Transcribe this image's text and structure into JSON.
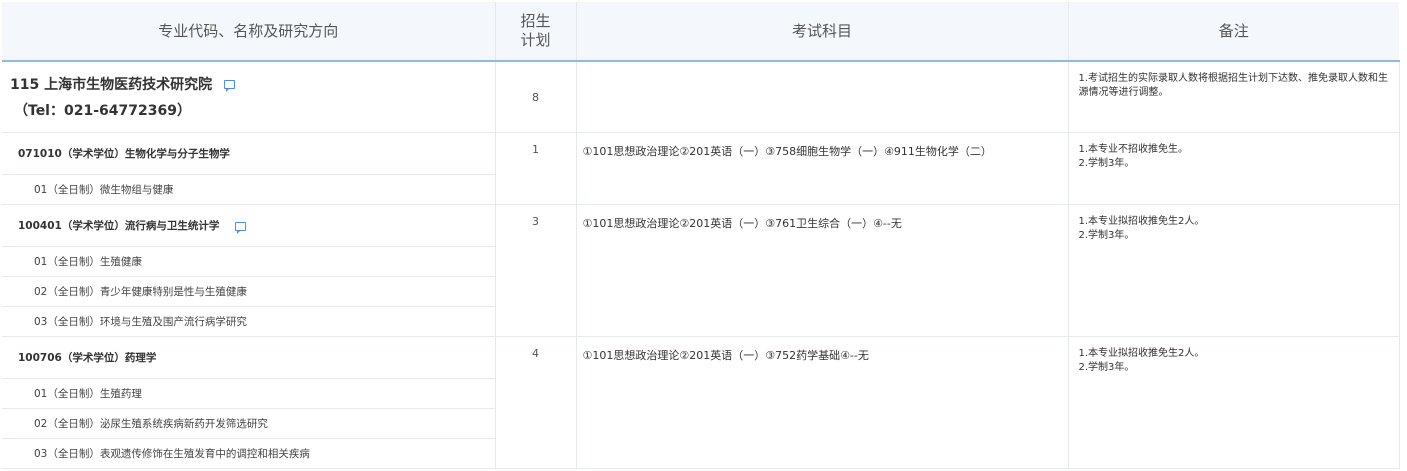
{
  "header": {
    "col1": "专业代码、名称及研究方向",
    "col2_line1": "招生",
    "col2_line2": "计划",
    "col3": "考试科目",
    "col4": "备注"
  },
  "institute": {
    "name": "115 上海市生物医药技术研究院",
    "tel": "（Tel：021-64772369）",
    "plan": "8",
    "exam": "",
    "note": "1.考试招生的实际录取人数将根据招生计划下达数、推免录取人数和生源情况等进行调整。"
  },
  "majors": [
    {
      "title": "071010（学术学位）生物化学与分子生物学",
      "plan": "1",
      "exam": "①101思想政治理论②201英语（一）③758细胞生物学（一）④911生物化学（二）",
      "note_line1": "1.本专业不招收推免生。",
      "note_line2": "2.学制3年。",
      "directions": [
        "01（全日制）微生物组与健康"
      ]
    },
    {
      "title": "100401（学术学位）流行病与卫生统计学",
      "plan": "3",
      "exam": "①101思想政治理论②201英语（一）③761卫生综合（一）④--无",
      "note_line1": "1.本专业拟招收推免生2人。",
      "note_line2": "2.学制3年。",
      "directions": [
        "01（全日制）生殖健康",
        "02（全日制）青少年健康特别是性与生殖健康",
        "03（全日制）环境与生殖及围产流行病学研究"
      ]
    },
    {
      "title": "100706（学术学位）药理学",
      "plan": "4",
      "exam": "①101思想政治理论②201英语（一）③752药学基础④--无",
      "note_line1": "1.本专业拟招收推免生2人。",
      "note_line2": "2.学制3年。",
      "directions": [
        "01（全日制）生殖药理",
        "02（全日制）泌尿生殖系统疾病新药开发筛选研究",
        "03（全日制）表观遗传修饰在生殖发育中的调控和相关疾病"
      ]
    }
  ]
}
